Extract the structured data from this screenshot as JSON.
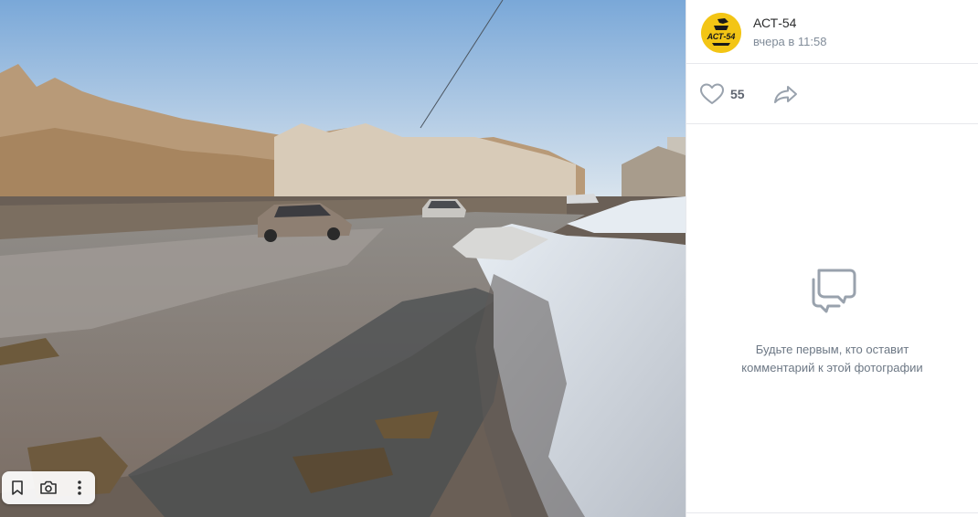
{
  "post": {
    "author": "АСТ-54",
    "time": "вчера в 11:58",
    "avatar_text": "АСТ-54"
  },
  "actions": {
    "likes": "55",
    "like_icon": "heart-outline-icon",
    "share_icon": "share-arrow-icon"
  },
  "comments": {
    "empty_line1": "Будьте первым, кто оставит",
    "empty_line2": "комментарий к этой фотографии",
    "icon": "comments-bubbles-icon"
  },
  "photo_tools": {
    "icons": [
      "bookmark-icon",
      "camera-search-icon",
      "more-vertical-icon"
    ]
  },
  "colors": {
    "avatar_bg": "#f3c515",
    "icon_gray": "#99a2ad",
    "text_secondary": "#818c99"
  }
}
